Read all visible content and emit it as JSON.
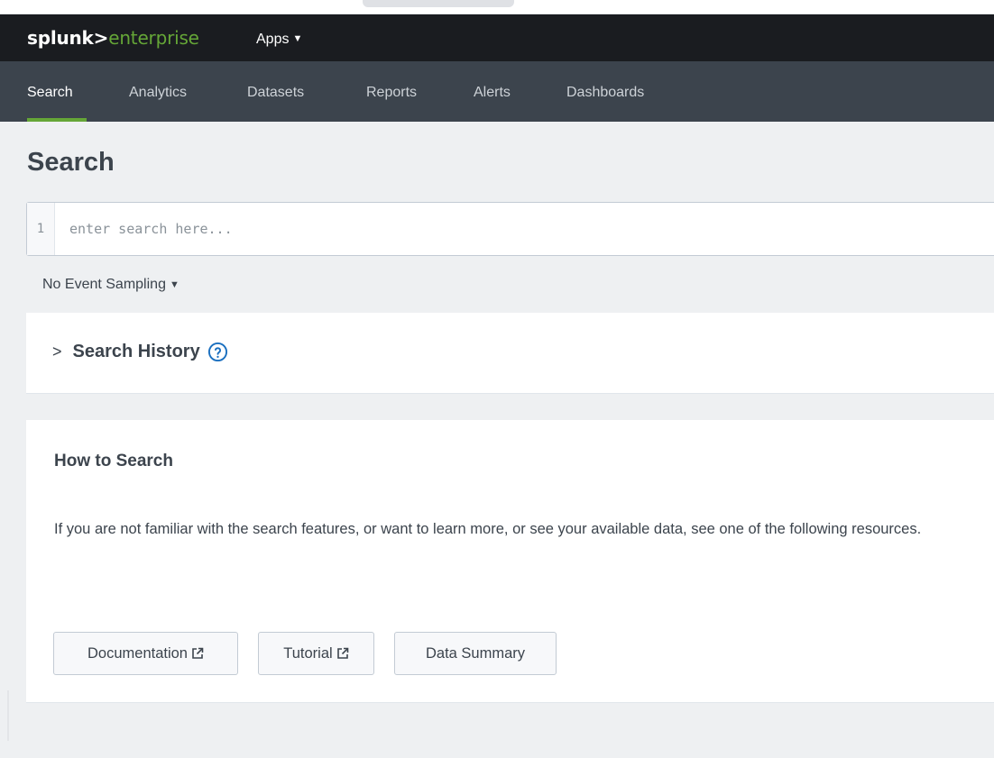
{
  "header": {
    "logo_brand": "splunk>",
    "logo_product": "enterprise",
    "apps_label": "Apps"
  },
  "app_nav": {
    "tabs": [
      {
        "label": "Search",
        "active": true
      },
      {
        "label": "Analytics",
        "active": false
      },
      {
        "label": "Datasets",
        "active": false
      },
      {
        "label": "Reports",
        "active": false
      },
      {
        "label": "Alerts",
        "active": false
      },
      {
        "label": "Dashboards",
        "active": false
      }
    ]
  },
  "page": {
    "title": "Search"
  },
  "search_bar": {
    "line_number": "1",
    "value": "",
    "placeholder": "enter search here..."
  },
  "sampling": {
    "label": "No Event Sampling"
  },
  "search_history": {
    "label": "Search History",
    "expanded": false
  },
  "how_to_search": {
    "title": "How to Search",
    "description": "If you are not familiar with the search features, or want to learn more, or see your available data, see one of the following resources.",
    "buttons": [
      {
        "label": "Documentation",
        "external": true
      },
      {
        "label": "Tutorial",
        "external": true
      },
      {
        "label": "Data Summary",
        "external": false
      }
    ]
  },
  "colors": {
    "topbar": "#1a1c20",
    "appbar": "#3c444d",
    "accent_green": "#65a637",
    "help_icon_blue": "#1a6fbf",
    "page_bg": "#eef0f2"
  }
}
